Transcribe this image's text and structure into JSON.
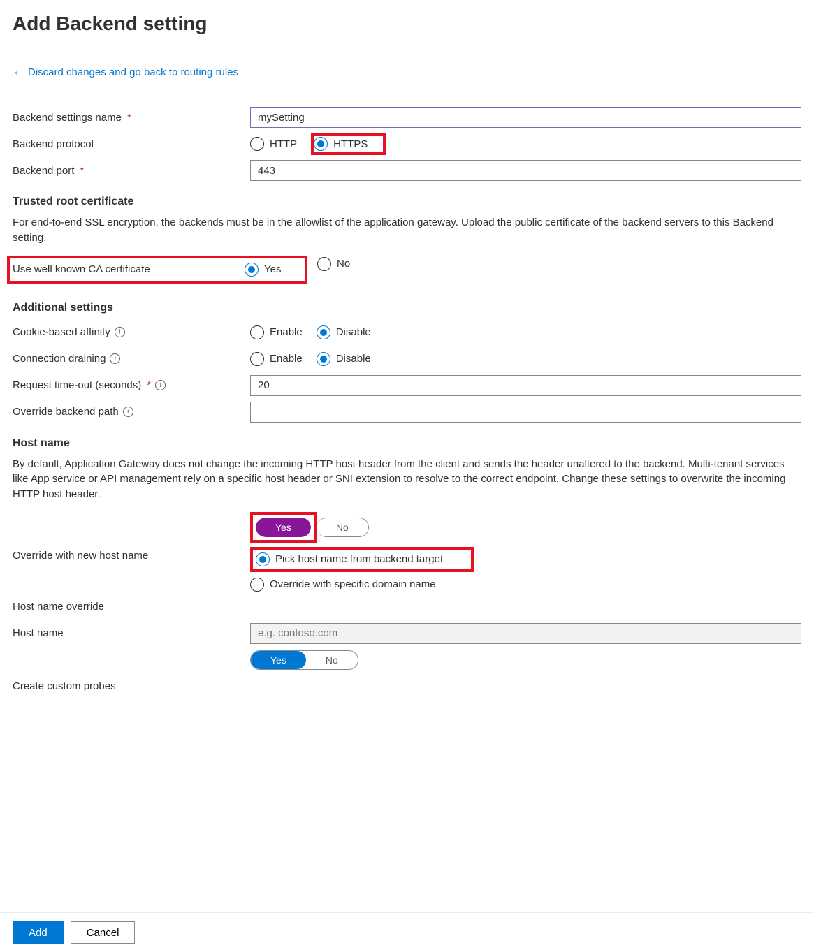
{
  "page": {
    "title": "Add Backend setting",
    "back_link": "Discard changes and go back to routing rules"
  },
  "fields": {
    "settings_name_label": "Backend settings name",
    "settings_name_value": "mySetting",
    "protocol_label": "Backend protocol",
    "protocol_http": "HTTP",
    "protocol_https": "HTTPS",
    "port_label": "Backend port",
    "port_value": "443"
  },
  "trusted": {
    "heading": "Trusted root certificate",
    "desc": "For end-to-end SSL encryption, the backends must be in the allowlist of the application gateway. Upload the public certificate of the backend servers to this Backend setting.",
    "ca_label": "Use well known CA certificate",
    "yes": "Yes",
    "no": "No"
  },
  "additional": {
    "heading": "Additional settings",
    "cookie_label": "Cookie-based affinity",
    "conn_label": "Connection draining",
    "enable": "Enable",
    "disable": "Disable",
    "timeout_label": "Request time-out (seconds)",
    "timeout_value": "20",
    "override_path_label": "Override backend path",
    "override_path_value": ""
  },
  "host": {
    "heading": "Host name",
    "desc": "By default, Application Gateway does not change the incoming HTTP host header from the client and sends the header unaltered to the backend. Multi-tenant services like App service or API management rely on a specific host header or SNI extension to resolve to the correct endpoint. Change these settings to overwrite the incoming HTTP host header.",
    "override_new_label": "Override with new host name",
    "pick_backend": "Pick host name from backend target",
    "override_specific": "Override with specific domain name",
    "override_label": "Host name override",
    "hostname_label": "Host name",
    "hostname_placeholder": "e.g. contoso.com",
    "probes_label": "Create custom probes",
    "yes": "Yes",
    "no": "No"
  },
  "footer": {
    "add": "Add",
    "cancel": "Cancel"
  }
}
